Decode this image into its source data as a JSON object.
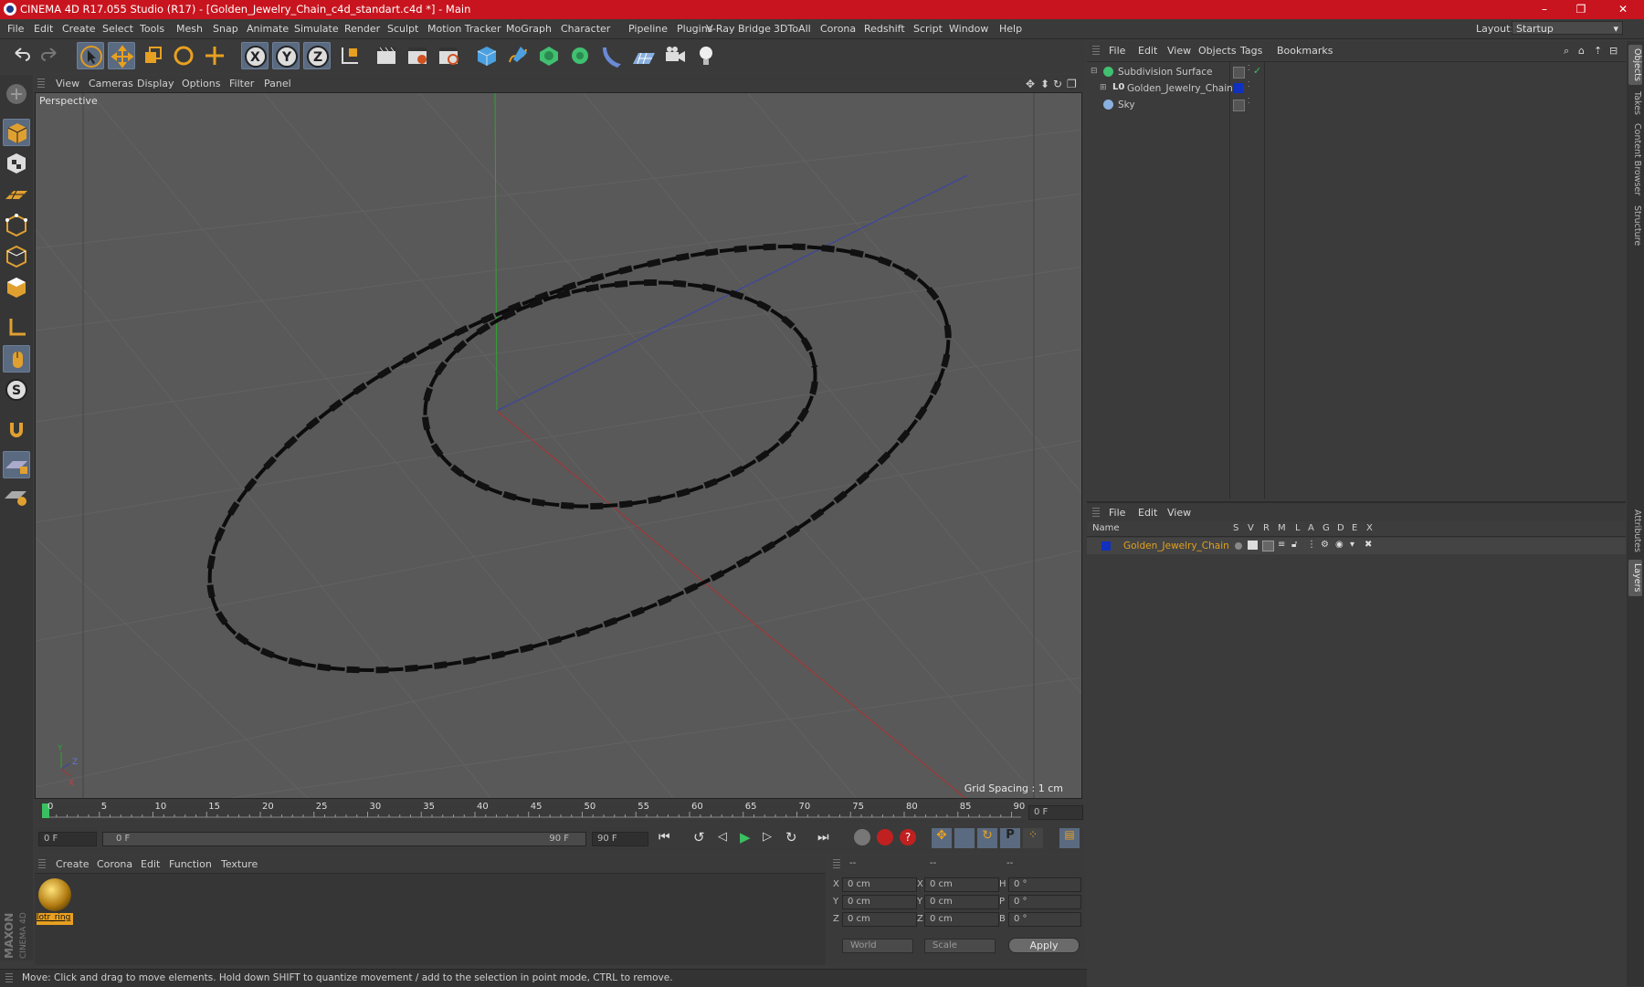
{
  "window": {
    "title": "CINEMA 4D R17.055 Studio (R17) - [Golden_Jewelry_Chain_c4d_standart.c4d *] - Main",
    "controls": {
      "minimize": "–",
      "maximize": "❐",
      "close": "✕"
    }
  },
  "menu": [
    "File",
    "Edit",
    "Create",
    "Select",
    "Tools",
    "Mesh",
    "Snap",
    "Animate",
    "Simulate",
    "Render",
    "Sculpt",
    "Motion Tracker",
    "MoGraph",
    "Character",
    "Pipeline",
    "Plugins",
    "V-Ray Bridge",
    "3DToAll",
    "Corona",
    "Redshift",
    "Script",
    "Window",
    "Help"
  ],
  "layout": {
    "label": "Layout:",
    "value": "Startup"
  },
  "viewport": {
    "menu": [
      "View",
      "Cameras",
      "Display",
      "Options",
      "Filter",
      "Panel"
    ],
    "label": "Perspective",
    "grid_spacing": "Grid Spacing : 1 cm",
    "axis_labels": {
      "y": "Y",
      "z": "Z",
      "x": "X"
    }
  },
  "timeline": {
    "ticks": [
      "0",
      "5",
      "10",
      "15",
      "20",
      "25",
      "30",
      "35",
      "40",
      "45",
      "50",
      "55",
      "60",
      "65",
      "70",
      "75",
      "80",
      "85",
      "90"
    ],
    "current_frame": "0 F",
    "start_field": "0 F",
    "range_start": "0 F",
    "range_end": "90 F",
    "end_field": "90 F"
  },
  "material_manager": {
    "menu": [
      "Create",
      "Corona",
      "Edit",
      "Function",
      "Texture"
    ],
    "material_name": "lotr_ring"
  },
  "coordinates": {
    "headers": [
      "--",
      "--",
      "--"
    ],
    "rows": [
      {
        "a": "X",
        "av": "0 cm",
        "b": "X",
        "bv": "0 cm",
        "c": "H",
        "cv": "0 °"
      },
      {
        "a": "Y",
        "av": "0 cm",
        "b": "Y",
        "bv": "0 cm",
        "c": "P",
        "cv": "0 °"
      },
      {
        "a": "Z",
        "av": "0 cm",
        "b": "Z",
        "bv": "0 cm",
        "c": "B",
        "cv": "0 °"
      }
    ],
    "world": "World",
    "scale": "Scale",
    "apply": "Apply"
  },
  "status": "Move: Click and drag to move elements. Hold down SHIFT to quantize movement / add to the selection in point mode, CTRL to remove.",
  "object_manager": {
    "menu": [
      "File",
      "Edit",
      "View",
      "Objects",
      "Tags",
      "Bookmarks"
    ],
    "objects": [
      {
        "name": "Subdivision Surface",
        "color": "#c8c8c8"
      },
      {
        "name": "Golden_Jewelry_Chain",
        "color": "#c8c8c8"
      },
      {
        "name": "Sky",
        "color": "#c8c8c8"
      }
    ]
  },
  "layer_manager": {
    "menu": [
      "File",
      "Edit",
      "View"
    ],
    "columns": [
      "Name",
      "S",
      "V",
      "R",
      "M",
      "L",
      "A",
      "G",
      "D",
      "E",
      "X"
    ],
    "layers": [
      {
        "name": "Golden_Jewelry_Chain",
        "color": "#e0a020"
      }
    ]
  },
  "right_tabs": [
    "Objects",
    "Takes",
    "Content Browser",
    "Structure",
    "Attributes",
    "Layers"
  ],
  "branding": "MAXON CINEMA 4D",
  "colors": {
    "accent": "#c8141e",
    "selection": "#5a6a80",
    "layer_swatch": "#1030c0"
  }
}
